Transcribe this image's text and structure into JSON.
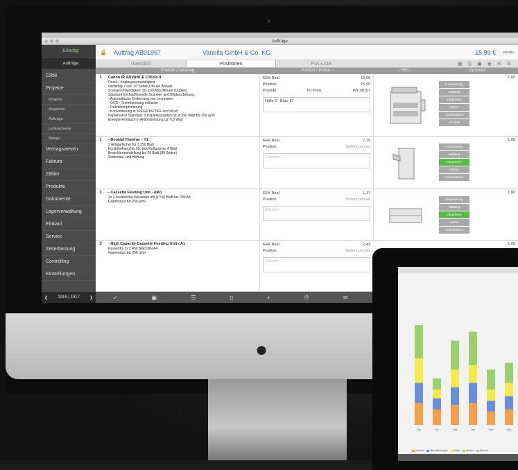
{
  "window_title": "Aufträge",
  "sidebar": {
    "status": "Erledigt",
    "active": "Aufträge",
    "items": [
      "CRM",
      "Projekte"
    ],
    "subitems": [
      "Projekte",
      "Angebote",
      "Aufträge",
      "Lieferscheine",
      "Belege"
    ],
    "more_items": [
      "Vertragswesen",
      "Faktura",
      "Zähler",
      "Produkte",
      "Dokumente",
      "Lagerverwaltung",
      "Einkauf",
      "Service",
      "Zeiterfassung",
      "Controlling",
      "Einstellungen"
    ],
    "pager": "1916 | 1917"
  },
  "header": {
    "order": "Auftrag AB01957",
    "company": "Vanella GmbH & Co. KG",
    "price": "15,99 €",
    "brand": "vanello"
  },
  "tabs": [
    "Überblick",
    "Positionen",
    "Pos-Liste"
  ],
  "active_tab": "Positionen",
  "columns": [
    "Produkt / Leistung",
    "- Kosten / Preise -",
    "- Bild -",
    "- Optionen -"
  ],
  "rows": [
    {
      "num": "1",
      "name": "Canon IR ADVANCE C3530i II",
      "lines": [
        "Druck-, Kopiergeschwindigkeit:",
        "vierfarbig + s/w: 30 Seiten DIN A4 /Minute",
        "Scangeschwindigkeit: bis 160 Abb./Minute (Duplex)",
        "Standard hochauflösende Scannen und Bildbearbeitung:",
        "- Automatische Entfernung von Leerseiten",
        "- OCR - Texterkennung inklusive",
        "- Datenkomprimierung",
        "- Konvertierung in JPEG/PDF/TIFF und Word",
        "Papiervorrat Standard: 2 Papierkassetten für je 550 Blatt bis 256 g/m²",
        "Energieverbrauch in Aktionsleistung ca. 0,8 Watt"
      ],
      "cost_label": "EEK Real",
      "cost_value": "12,00",
      "pos_label": "Position",
      "pos_value": "16,99",
      "preset": "Produkt",
      "preset_val": "Ihr Preis",
      "preset_code": "IMC08167",
      "note": "Halle 3 - Büro 17",
      "qty": "1,00",
      "options": [
        "Finanzierung",
        "Wartung",
        "Integrieren",
        "Option",
        "Unterdrücken",
        "VT aktiv"
      ]
    },
    {
      "num": "1",
      "name": "- Booklet Finisher - Y1",
      "lines": [
        "2 Ablagefächer für 3.250 Blatt",
        "Kombiheftung bis 50, Eck-Heftung bis 4 Blatt",
        "Broschürenerstellung bis 20 Blatt (80 Seiten)",
        "Seitenfalz- und Heftung"
      ],
      "cost_label": "EEK Real",
      "cost_value": "7,19",
      "pos_label": "Position",
      "pos_value": "",
      "sub": "Seitennummer",
      "note": "Standort",
      "qty": "1,00",
      "options": [
        "Finanzierung",
        "Wartung",
        "Integrieren",
        "Option",
        "Unterdrücken"
      ]
    },
    {
      "num": "2",
      "name": "- Cassette Feeding Unit - AW1",
      "lines": [
        "2x 2 zusätzliche Kassetten mit je 550 Blatt bis DIN A3",
        "Grammatur bis 256 g/m²"
      ],
      "cost_label": "EEK Real",
      "cost_value": "1,17",
      "pos_label": "Position",
      "pos_value": "",
      "sub": "Seitennummer",
      "note": "Standort",
      "qty": "1,00",
      "options": [
        "Finanzierung",
        "Wartung",
        "Integrieren",
        "Option",
        "Unterdrücken"
      ]
    },
    {
      "num": "3",
      "name": "- High Capacity Cassette Feeding Unit - A1",
      "lines": [
        "Kassettfül 1x 2.450 Blatt DIN A4",
        "Grammatur bis 256 g/m²"
      ],
      "cost_label": "EEK Real",
      "cost_value": "2,43",
      "pos_label": "Position",
      "pos_value": "",
      "sub": "Seitennummer",
      "note": "Standort",
      "qty": "1,00",
      "options": []
    }
  ],
  "chart_data": {
    "type": "bar",
    "categories": [
      "Bio",
      "Fin",
      "Dat",
      "Jan",
      "Feb",
      "Mar"
    ],
    "series": [
      {
        "name": "Verkauf",
        "values": [
          20,
          14,
          18,
          20,
          12,
          14
        ]
      },
      {
        "name": "Dienstleistungen",
        "values": [
          18,
          10,
          16,
          18,
          10,
          12
        ]
      },
      {
        "name": "Miete",
        "values": [
          22,
          8,
          16,
          16,
          10,
          12
        ]
      },
      {
        "name": "Sonstige",
        "values": [
          30,
          10,
          26,
          30,
          18,
          18
        ]
      }
    ],
    "legend": [
      "Verkauf",
      "Dienstleistungen",
      "Miete",
      "Mieten",
      "Service"
    ],
    "colors": [
      "#f2a14a",
      "#6a8fd8",
      "#f4e94e",
      "#9ccf6e",
      "#bbbbbb"
    ]
  }
}
